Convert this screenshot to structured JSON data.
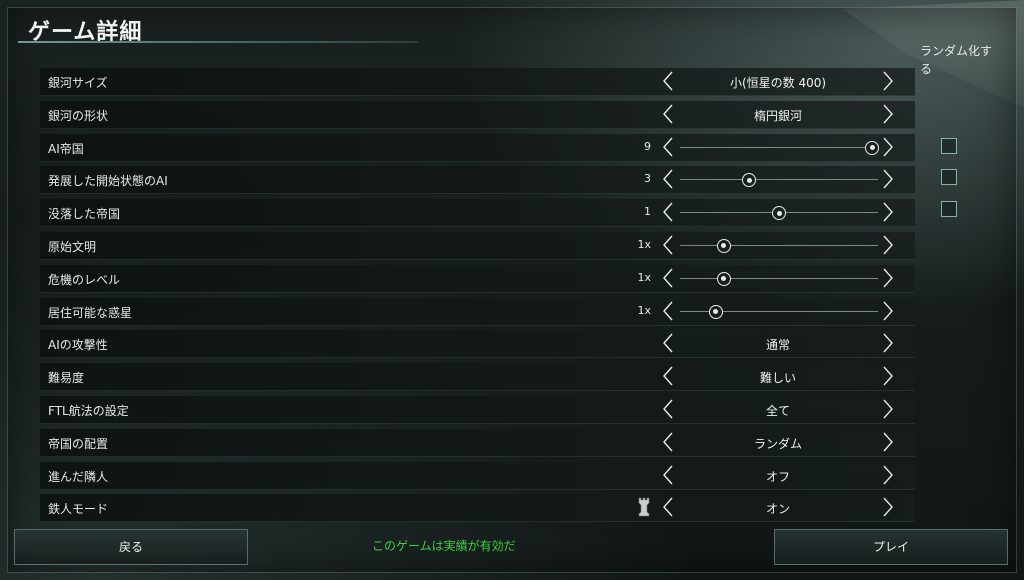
{
  "title": "ゲーム詳細",
  "random_header": "ランダム化する",
  "rows": [
    {
      "label": "銀河サイズ",
      "type": "select",
      "value": "小(恒星の数 400)"
    },
    {
      "label": "銀河の形状",
      "type": "select",
      "value": "楕円銀河"
    },
    {
      "label": "AI帝国",
      "type": "slider",
      "number": "9",
      "level": 0.97,
      "randomize": true
    },
    {
      "label": "発展した開始状態のAI",
      "type": "slider",
      "number": "3",
      "level": 0.35,
      "randomize": true
    },
    {
      "label": "没落した帝国",
      "type": "slider",
      "number": "1",
      "level": 0.5,
      "randomize": true
    },
    {
      "label": "原始文明",
      "type": "slider",
      "number": "1x",
      "level": 0.22
    },
    {
      "label": "危機のレベル",
      "type": "slider",
      "number": "1x",
      "level": 0.22
    },
    {
      "label": "居住可能な惑星",
      "type": "slider",
      "number": "1x",
      "level": 0.18
    },
    {
      "label": "AIの攻撃性",
      "type": "select",
      "value": "通常"
    },
    {
      "label": "難易度",
      "type": "select",
      "value": "難しい"
    },
    {
      "label": "FTL航法の設定",
      "type": "select",
      "value": "全て"
    },
    {
      "label": "帝国の配置",
      "type": "select",
      "value": "ランダム"
    },
    {
      "label": "進んだ隣人",
      "type": "select",
      "value": "オフ"
    },
    {
      "label": "鉄人モード",
      "type": "select",
      "value": "オン",
      "icon": "rook-icon"
    }
  ],
  "footer": {
    "back_label": "戻る",
    "play_label": "プレイ",
    "achievement_text": "このゲームは実績が有効だ"
  },
  "colors": {
    "achievement": "#3fcf3f",
    "checkbox_border": "#7fb6a8",
    "accent_line": "#78aaa0"
  }
}
